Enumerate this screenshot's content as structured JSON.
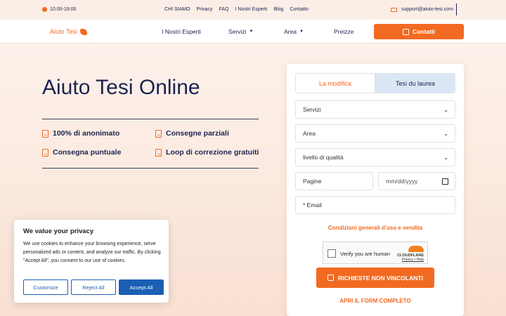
{
  "topbar": {
    "hours": "10:00-19:00",
    "links": [
      "CHI SIAMO",
      "Privacy",
      "FAQ",
      "I Nostri Esperti",
      "Blog",
      "Contatto"
    ],
    "email": "support@aiuto-tesi.com"
  },
  "nav": {
    "logo": "Aiuto Tesi",
    "items": [
      "I Nostri Esperti",
      "Servizi",
      "Area",
      "Preizze"
    ],
    "contact_label": "Contatti"
  },
  "hero": {
    "title": "Aiuto Tesi Online",
    "features": [
      "100% di anonimato",
      "Consegne parziali",
      "Consegna puntuale",
      "Loop di correzione gratuiti"
    ]
  },
  "form": {
    "tabs": [
      "La modifica",
      "Tesi du laurea"
    ],
    "active_tab": "Tesi du laurea",
    "services_select": "Servizi",
    "area_select": "Area",
    "quality_select": "livello di qualità",
    "pages_placeholder": "Pagine",
    "date_placeholder": "mm/dd/yyyy",
    "email_placeholder": "* Email",
    "terms_link": "Condizioni generali d’uso e vendita",
    "captcha": {
      "label": "Verify you are human",
      "brand": "CLOUDFLARE",
      "links": "Privacy • Help"
    },
    "submit_label": "RICHIESTE NON VINCOLANTI",
    "open_full_label": "APRI IL FORM COMPLETO"
  },
  "cookie": {
    "title": "We value your privacy",
    "text": "We use cookies to enhance your browsing experience, serve personalized ads or content, and analyze our traffic. By clicking \"Accept All\", you consent to our use of cookies.",
    "customize": "Customize",
    "reject": "Reject All",
    "accept": "Accept All"
  },
  "colors": {
    "accent": "#f26a21",
    "navy": "#1d2350",
    "cookie_blue": "#1a5fb4",
    "tab_active_bg": "#dbe6f5"
  }
}
